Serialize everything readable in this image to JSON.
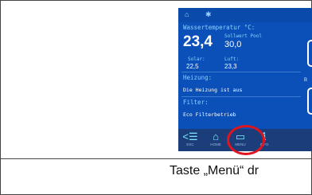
{
  "screen": {
    "top_icons": [
      "home-icon",
      "pump-icon"
    ],
    "water_label": "Wassertemperatur °C:",
    "water_value": "23,4",
    "setpoint_label": "Sollwert Pool",
    "setpoint_value": "30,0",
    "solar_label": "Solar:",
    "solar_value": "22,5",
    "air_label": "Luft:",
    "air_value": "23,3",
    "heating_label": "Heizung:",
    "heating_text": "Die Heizung ist aus",
    "filter_label": "Filter:",
    "filter_text": "Eco Filterbetrieb",
    "side_label": "B",
    "nav": [
      {
        "icon": "back-icon",
        "label": "ESC"
      },
      {
        "icon": "home-icon",
        "label": "HOME"
      },
      {
        "icon": "menu-icon",
        "label": "MENU"
      },
      {
        "icon": "info-icon",
        "label": "INFO"
      }
    ]
  },
  "caption": "Taste „Menü“ dr",
  "colors": {
    "screen_bg": "#0a50b8",
    "highlight": "#e0141e"
  }
}
